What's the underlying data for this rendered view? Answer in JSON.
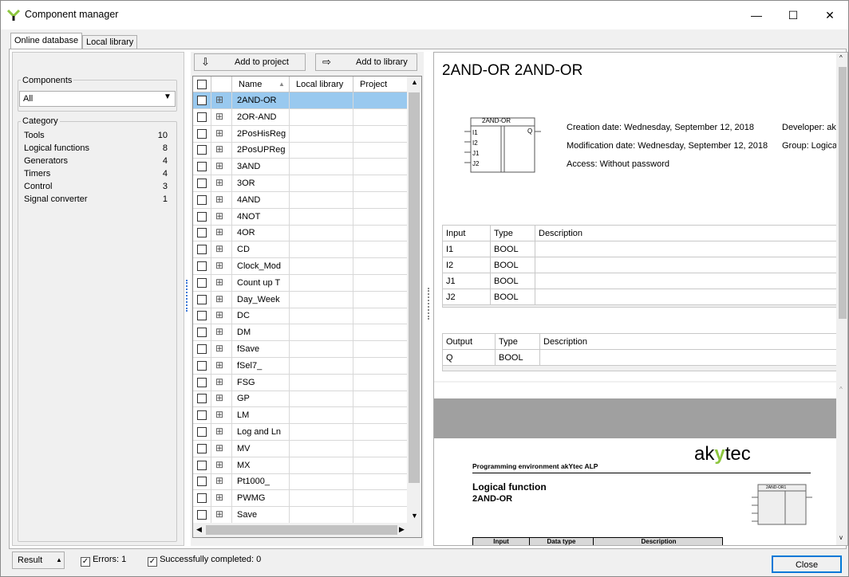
{
  "window": {
    "title": "Component manager",
    "minimize": "—",
    "maximize": "☐",
    "close": "✕"
  },
  "tabs": [
    {
      "label": "Online database"
    },
    {
      "label": "Local library"
    }
  ],
  "left": {
    "components_label": "Components",
    "components_value": "All",
    "category_label": "Category",
    "categories": [
      {
        "name": "Tools",
        "count": "10"
      },
      {
        "name": "Logical functions",
        "count": "8"
      },
      {
        "name": "Generators",
        "count": "4"
      },
      {
        "name": "Timers",
        "count": "4"
      },
      {
        "name": "Control",
        "count": "3"
      },
      {
        "name": "Signal converter",
        "count": "1"
      }
    ]
  },
  "toolbar": {
    "add_project": "Add to project",
    "add_library": "Add to library"
  },
  "list": {
    "columns": [
      "Name",
      "Local library",
      "Project"
    ],
    "items": [
      "2AND-OR",
      "2OR-AND",
      "2PosHisReg",
      "2PosUPReg",
      "3AND",
      "3OR",
      "4AND",
      "4NOT",
      "4OR",
      "CD",
      "Clock_Mod",
      "Count up T",
      "Day_Week",
      "DC",
      "DM",
      "fSave",
      "fSel7_",
      "FSG",
      "GP",
      "LM",
      "Log and Ln",
      "MV",
      "MX",
      "Pt1000_",
      "PWMG",
      "Save"
    ]
  },
  "detail": {
    "title": "2AND-OR 2AND-OR",
    "block_name": "2AND-OR",
    "block_inputs": [
      "I1",
      "I2",
      "J1",
      "J2"
    ],
    "block_output": "Q",
    "creation": "Creation date: Wednesday, September 12, 2018",
    "modification": "Modification date: Wednesday, September 12, 2018",
    "access": "Access: Without password",
    "developer": "Developer: ak",
    "group": "Group: Logical",
    "input_headers": [
      "Input",
      "Type",
      "Description"
    ],
    "inputs": [
      [
        "I1",
        "BOOL",
        ""
      ],
      [
        "I2",
        "BOOL",
        ""
      ],
      [
        "J1",
        "BOOL",
        ""
      ],
      [
        "J2",
        "BOOL",
        ""
      ]
    ],
    "output_headers": [
      "Output",
      "Type",
      "Description"
    ],
    "outputs": [
      [
        "Q",
        "BOOL",
        ""
      ]
    ]
  },
  "preview": {
    "env": "Programming environment akYtec ALP",
    "logo_a": "ak",
    "logo_b": "tec",
    "heading1": "Logical function",
    "heading2": "2AND-OR",
    "block_name": "2AND-OR1",
    "table_headers": [
      "Input",
      "Data type",
      "Description"
    ]
  },
  "status": {
    "result": "Result",
    "errors": "Errors: 1",
    "success": "Successfully completed: 0",
    "close": "Close"
  }
}
